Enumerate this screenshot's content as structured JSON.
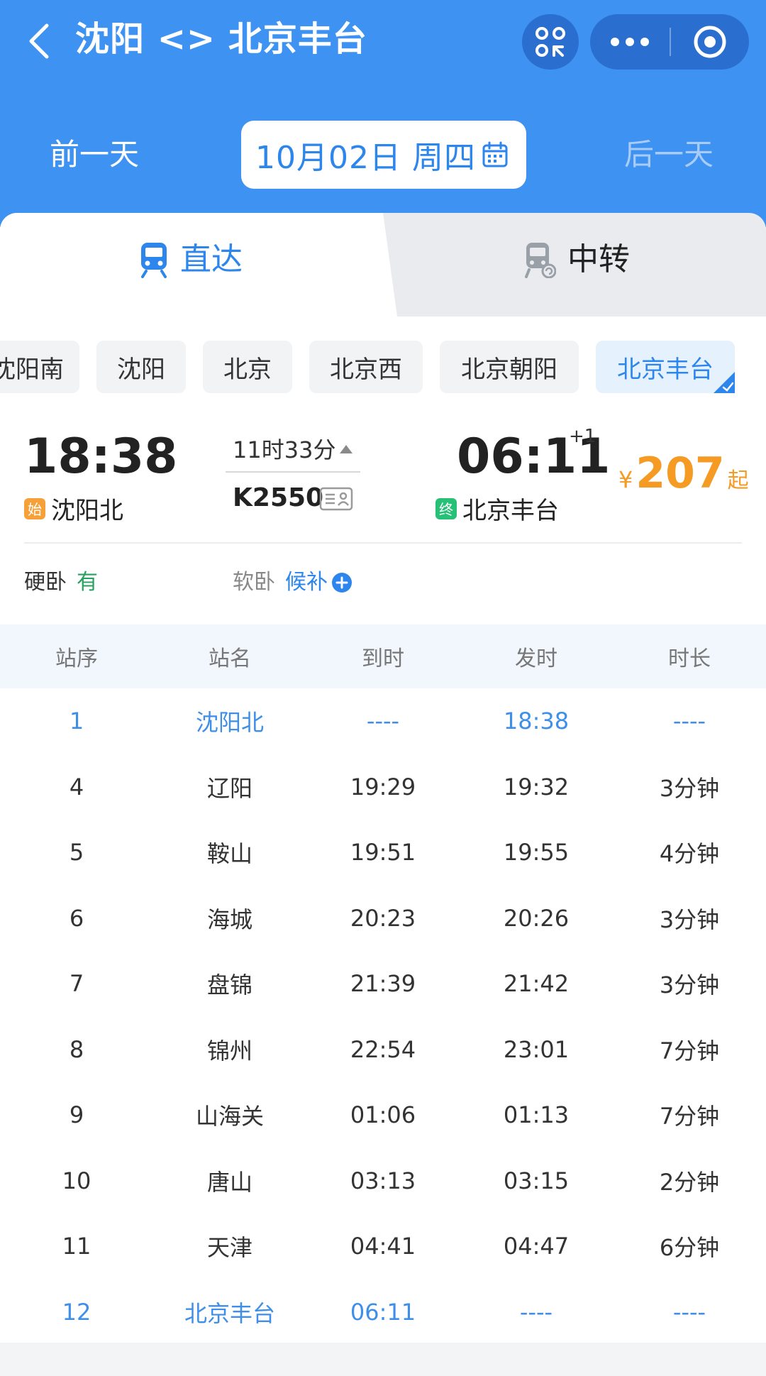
{
  "header": {
    "title": "沈阳 <> 北京丰台",
    "back_icon": "chevron-left-icon",
    "grid_icon": "qr-grid-icon",
    "more_icon": "more-dots-icon",
    "target_icon": "target-icon",
    "accent_color": "#3d92f2"
  },
  "date_bar": {
    "prev": "前一天",
    "date": "10月02日 周四",
    "next": "后一天",
    "calendar_icon": "calendar-icon"
  },
  "tabs": [
    {
      "label": "直达",
      "icon": "train-icon",
      "active": true
    },
    {
      "label": "中转",
      "icon": "train-transfer-icon",
      "active": false
    }
  ],
  "stations": [
    {
      "label": "沈阳南",
      "active": false
    },
    {
      "label": "沈阳",
      "active": false
    },
    {
      "label": "北京",
      "active": false
    },
    {
      "label": "北京西",
      "active": false
    },
    {
      "label": "北京朝阳",
      "active": false
    },
    {
      "label": "北京丰台",
      "active": true
    }
  ],
  "train": {
    "dep_time": "18:38",
    "dep_station": "沈阳北",
    "dep_badge": "始",
    "duration": "11时33分",
    "train_no": "K2550",
    "arr_time": "06:11",
    "arr_day_offset": "+1",
    "arr_station": "北京丰台",
    "arr_badge": "终",
    "price_symbol": "¥",
    "price": "207",
    "price_suffix": "起"
  },
  "seats": [
    {
      "name": "硬卧",
      "status": "有"
    },
    {
      "name": "软卧",
      "status": "候补"
    }
  ],
  "stops_table": {
    "headers": [
      "站序",
      "站名",
      "到时",
      "发时",
      "时长"
    ],
    "rows": [
      [
        "1",
        "沈阳北",
        "----",
        "18:38",
        "----"
      ],
      [
        "4",
        "辽阳",
        "19:29",
        "19:32",
        "3分钟"
      ],
      [
        "5",
        "鞍山",
        "19:51",
        "19:55",
        "4分钟"
      ],
      [
        "6",
        "海城",
        "20:23",
        "20:26",
        "3分钟"
      ],
      [
        "7",
        "盘锦",
        "21:39",
        "21:42",
        "3分钟"
      ],
      [
        "8",
        "锦州",
        "22:54",
        "23:01",
        "7分钟"
      ],
      [
        "9",
        "山海关",
        "01:06",
        "01:13",
        "7分钟"
      ],
      [
        "10",
        "唐山",
        "03:13",
        "03:15",
        "2分钟"
      ],
      [
        "11",
        "天津",
        "04:41",
        "04:47",
        "6分钟"
      ],
      [
        "12",
        "北京丰台",
        "06:11",
        "----",
        "----"
      ]
    ]
  }
}
